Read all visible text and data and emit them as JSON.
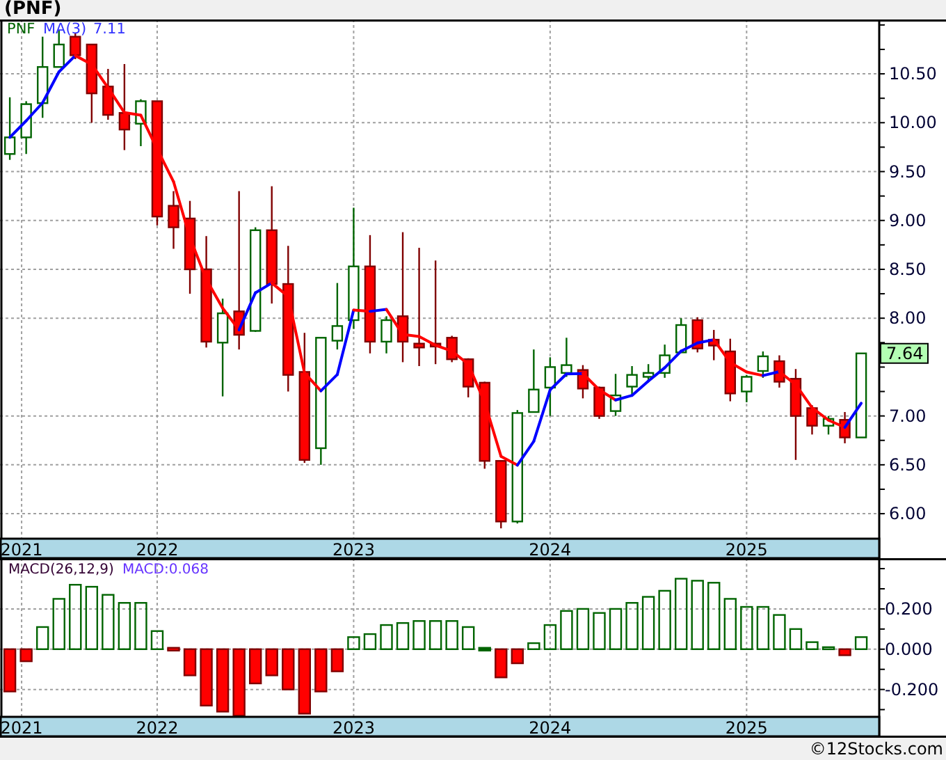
{
  "title": "(PNF)",
  "price_chart": {
    "legend": {
      "indicator": "MA(3)",
      "indicator_value": "7.11"
    },
    "last_price": "7.64",
    "chart_data": {
      "type": "candlestick",
      "grid": true,
      "xlim": [
        2021.2,
        2025.675
      ],
      "ylim": [
        5.73,
        11.056
      ],
      "x": [
        2021.25,
        2021.3333,
        2021.4167,
        2021.5,
        2021.5833,
        2021.6667,
        2021.75,
        2021.8333,
        2021.9167,
        2022,
        2022.0833,
        2022.1667,
        2022.25,
        2022.3333,
        2022.4167,
        2022.5,
        2022.5833,
        2022.6667,
        2022.75,
        2022.8333,
        2022.9167,
        2023,
        2023.0833,
        2023.1667,
        2023.25,
        2023.3333,
        2023.4167,
        2023.5,
        2023.5833,
        2023.6667,
        2023.75,
        2023.8333,
        2023.9167,
        2024,
        2024.0833,
        2024.1667,
        2024.25,
        2024.3333,
        2024.4167,
        2024.5,
        2024.5833,
        2024.6667,
        2024.75,
        2024.8333,
        2024.9167,
        2025,
        2025.0833,
        2025.1667,
        2025.25,
        2025.3333,
        2025.4167,
        2025.5,
        2025.5833
      ],
      "series": [
        {
          "name": "PNF",
          "ohlc": [
            [
              9.68,
              10.26,
              9.62,
              9.85
            ],
            [
              9.85,
              10.22,
              9.68,
              10.19
            ],
            [
              10.2,
              10.88,
              10.05,
              10.57
            ],
            [
              10.57,
              10.95,
              10.57,
              10.8
            ],
            [
              10.88,
              10.92,
              10.65,
              10.69
            ],
            [
              10.8,
              10.8,
              10.0,
              10.3
            ],
            [
              10.37,
              10.55,
              10.03,
              10.08
            ],
            [
              10.1,
              10.6,
              9.72,
              9.93
            ],
            [
              9.99,
              10.24,
              9.76,
              10.22
            ],
            [
              10.22,
              10.22,
              8.95,
              9.04
            ],
            [
              9.15,
              9.3,
              8.71,
              8.93
            ],
            [
              9.02,
              9.2,
              8.25,
              8.5
            ],
            [
              8.5,
              8.84,
              7.7,
              7.76
            ],
            [
              7.75,
              8.2,
              7.2,
              8.05
            ],
            [
              8.07,
              9.3,
              7.68,
              7.83
            ],
            [
              7.87,
              8.93,
              7.86,
              8.9
            ],
            [
              8.9,
              9.35,
              8.15,
              8.35
            ],
            [
              8.35,
              8.74,
              7.25,
              7.42
            ],
            [
              7.45,
              7.85,
              6.52,
              6.55
            ],
            [
              6.67,
              7.8,
              6.5,
              7.8
            ],
            [
              7.77,
              8.36,
              7.68,
              7.92
            ],
            [
              7.98,
              9.13,
              7.89,
              8.53
            ],
            [
              8.53,
              8.85,
              7.64,
              7.76
            ],
            [
              7.76,
              8.02,
              7.64,
              7.98
            ],
            [
              8.02,
              8.88,
              7.55,
              7.76
            ],
            [
              7.74,
              8.72,
              7.51,
              7.7
            ],
            [
              7.74,
              8.59,
              7.53,
              7.71
            ],
            [
              7.8,
              7.82,
              7.55,
              7.58
            ],
            [
              7.58,
              7.59,
              7.19,
              7.3
            ],
            [
              7.34,
              7.35,
              6.46,
              6.54
            ],
            [
              6.54,
              6.54,
              5.85,
              5.92
            ],
            [
              5.92,
              7.06,
              5.9,
              7.03
            ],
            [
              7.04,
              7.68,
              7.04,
              7.27
            ],
            [
              7.29,
              7.6,
              7.0,
              7.5
            ],
            [
              7.44,
              7.8,
              7.4,
              7.52
            ],
            [
              7.47,
              7.52,
              7.18,
              7.28
            ],
            [
              7.29,
              7.3,
              6.97,
              7.0
            ],
            [
              7.05,
              7.43,
              7.0,
              7.21
            ],
            [
              7.3,
              7.51,
              7.22,
              7.42
            ],
            [
              7.4,
              7.53,
              7.37,
              7.44
            ],
            [
              7.44,
              7.73,
              7.39,
              7.62
            ],
            [
              7.65,
              8.0,
              7.65,
              7.93
            ],
            [
              7.98,
              8.01,
              7.65,
              7.69
            ],
            [
              7.78,
              7.88,
              7.57,
              7.72
            ],
            [
              7.66,
              7.79,
              7.15,
              7.23
            ],
            [
              7.25,
              7.42,
              7.14,
              7.4
            ],
            [
              7.46,
              7.66,
              7.39,
              7.61
            ],
            [
              7.56,
              7.62,
              7.29,
              7.35
            ],
            [
              7.38,
              7.48,
              6.55,
              7.0
            ],
            [
              7.08,
              7.11,
              6.81,
              6.9
            ],
            [
              6.9,
              7.0,
              6.81,
              6.97
            ],
            [
              6.96,
              7.04,
              6.72,
              6.78
            ],
            [
              6.78,
              7.64,
              6.78,
              7.64
            ]
          ]
        }
      ],
      "yticks": [
        {
          "value": 10.5,
          "label": "10.50"
        },
        {
          "value": 10,
          "label": "10.00"
        },
        {
          "value": 9.5,
          "label": "9.50"
        },
        {
          "value": 9,
          "label": "9.00"
        },
        {
          "value": 8.5,
          "label": "8.50"
        },
        {
          "value": 8,
          "label": "8.00"
        },
        {
          "value": 7,
          "label": "7.00"
        },
        {
          "value": 6.5,
          "label": "6.50"
        },
        {
          "value": 6,
          "label": "6.00"
        }
      ],
      "xticks": [
        {
          "value": 2021.31,
          "label": "2021"
        },
        {
          "value": 2022,
          "label": "2022"
        },
        {
          "value": 2023,
          "label": "2023"
        },
        {
          "value": 2024,
          "label": "2024"
        },
        {
          "value": 2025,
          "label": "2025"
        }
      ]
    }
  },
  "macd_chart": {
    "legend": {
      "value": "MACD:0.068"
    },
    "chart_data": {
      "type": "bar",
      "grid": true,
      "xlim": [
        2021.2,
        2025.675
      ],
      "ylim": [
        -0.336,
        0.452
      ],
      "x": [
        2021.25,
        2021.3333,
        2021.4167,
        2021.5,
        2021.5833,
        2021.6667,
        2021.75,
        2021.8333,
        2021.9167,
        2022,
        2022.0833,
        2022.1667,
        2022.25,
        2022.3333,
        2022.4167,
        2022.5,
        2022.5833,
        2022.6667,
        2022.75,
        2022.8333,
        2022.9167,
        2023,
        2023.0833,
        2023.1667,
        2023.25,
        2023.3333,
        2023.4167,
        2023.5,
        2023.5833,
        2023.6667,
        2023.75,
        2023.8333,
        2023.9167,
        2024,
        2024.0833,
        2024.1667,
        2024.25,
        2024.3333,
        2024.4167,
        2024.5,
        2024.5833,
        2024.6667,
        2024.75,
        2024.8333,
        2024.9167,
        2025,
        2025.0833,
        2025.1667,
        2025.25,
        2025.3333,
        2025.4167,
        2025.5,
        2025.5833
      ],
      "series": [
        {
          "name": "MACD(26,12,9)",
          "color": "#006400",
          "values": [
            null,
            null,
            0.11,
            0.25,
            0.32,
            0.31,
            0.27,
            0.23,
            0.23,
            0.09,
            null,
            null,
            null,
            null,
            null,
            null,
            null,
            null,
            null,
            null,
            null,
            0.06,
            0.075,
            0.12,
            0.13,
            0.14,
            0.14,
            0.14,
            0.11,
            0.005,
            null,
            null,
            0.03,
            0.12,
            0.19,
            0.2,
            0.18,
            0.2,
            0.23,
            0.26,
            0.29,
            0.35,
            0.34,
            0.33,
            0.25,
            0.21,
            0.21,
            0.17,
            0.1,
            0.035,
            0.01,
            null,
            0.06
          ]
        },
        {
          "color": "#ff0000",
          "values": [
            -0.21,
            -0.06,
            null,
            null,
            null,
            null,
            null,
            null,
            null,
            null,
            -0.005,
            -0.13,
            -0.28,
            -0.31,
            -0.33,
            -0.17,
            -0.13,
            -0.2,
            -0.32,
            -0.21,
            -0.11,
            null,
            null,
            null,
            null,
            null,
            null,
            null,
            null,
            null,
            -0.14,
            -0.07,
            null,
            null,
            null,
            null,
            null,
            null,
            null,
            null,
            null,
            null,
            null,
            null,
            null,
            null,
            null,
            null,
            null,
            null,
            null,
            -0.03,
            null
          ]
        }
      ],
      "yticks": [
        {
          "value": 0.2,
          "label": "0.200"
        },
        {
          "value": 0,
          "label": "0.000"
        },
        {
          "value": -0.2,
          "label": "-0.200"
        }
      ],
      "xticks": [
        {
          "value": 2021.31,
          "label": "2021"
        },
        {
          "value": 2022,
          "label": "2022"
        },
        {
          "value": 2023,
          "label": "2023"
        },
        {
          "value": 2024,
          "label": "2024"
        },
        {
          "value": 2025,
          "label": "2025"
        }
      ]
    }
  },
  "footer": "©12Stocks.com"
}
